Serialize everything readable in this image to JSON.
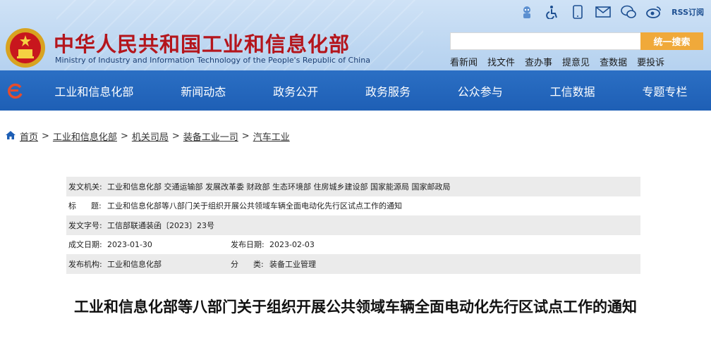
{
  "header": {
    "site_name": "中华人民共和国工业和信息化部",
    "site_name_en": "Ministry of Industry and Information Technology of the People's Republic of China",
    "top_icons": [
      "robot-icon",
      "accessibility-icon",
      "mobile-icon",
      "mail-icon",
      "wechat-icon",
      "weibo-icon"
    ],
    "rss_label": "RSS订阅",
    "search": {
      "placeholder": "",
      "value": "",
      "button_label": "统一搜索"
    },
    "quick_links": [
      "看新闻",
      "找文件",
      "查办事",
      "提意见",
      "查数据",
      "要投诉"
    ]
  },
  "nav": {
    "items": [
      "工业和信息化部",
      "新闻动态",
      "政务公开",
      "政务服务",
      "公众参与",
      "工信数据",
      "专题专栏"
    ]
  },
  "breadcrumb": [
    "首页",
    "工业和信息化部",
    "机关司局",
    "装备工业一司",
    "汽车工业"
  ],
  "meta": {
    "issuer_label": "发文机关:",
    "issuer_value": "工业和信息化部 交通运输部 发展改革委 财政部 生态环境部 住房城乡建设部 国家能源局 国家邮政局",
    "title_label": "标      题:",
    "title_value": "工业和信息化部等八部门关于组织开展公共领域车辆全面电动化先行区试点工作的通知",
    "doc_no_label": "发文字号:",
    "doc_no_value": "工信部联通装函〔2023〕23号",
    "date_label": "成文日期:",
    "date_value": "2023-01-30",
    "pub_date_label": "发布日期:",
    "pub_date_value": "2023-02-03",
    "publisher_label": "发布机构:",
    "publisher_value": "工业和信息化部",
    "category_label": "分      类:",
    "category_value": "装备工业管理"
  },
  "document": {
    "title": "工业和信息化部等八部门关于组织开展公共领域车辆全面电动化先行区试点工作的通知"
  },
  "colors": {
    "brand_red": "#b4151c",
    "nav_blue": "#1e5fb5",
    "search_orange": "#f0a93a"
  }
}
